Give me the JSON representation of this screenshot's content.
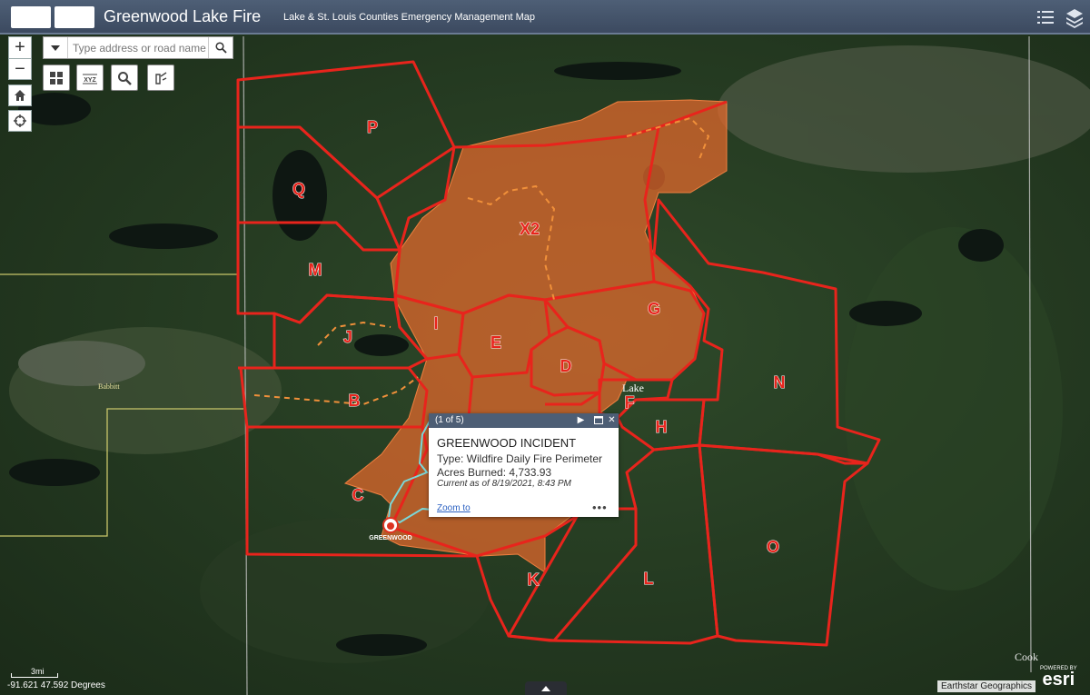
{
  "header": {
    "title": "Greenwood Lake Fire",
    "subtitle": "Lake & St. Louis Counties Emergency Management Map"
  },
  "search": {
    "placeholder": "Type address or road name"
  },
  "map": {
    "zone_labels": [
      "P",
      "Q",
      "M",
      "X2",
      "I",
      "J",
      "E",
      "G",
      "D",
      "B",
      "F",
      "H",
      "N",
      "C",
      "K",
      "L",
      "O"
    ],
    "place_labels": {
      "babbitt": "Babbitt",
      "lake": "Lake",
      "cook": "Cook"
    },
    "incident_marker_label": "GREENWOOD"
  },
  "popup": {
    "count": "(1 of 5)",
    "title": "GREENWOOD INCIDENT",
    "type_line": "Type: Wildfire Daily Fire Perimeter",
    "acres_line": "Acres Burned: 4,733.93",
    "current_line": "Current as of 8/19/2021, 8:43 PM",
    "zoom_link": "Zoom to",
    "more": "•••"
  },
  "status": {
    "coordinates": "-91.621 47.592 Degrees",
    "scale": "3mi",
    "attribution": "Earthstar Geographics",
    "esri_powered": "POWERED BY",
    "esri": "esri"
  },
  "colors": {
    "zone_outline": "#e8241c",
    "fire_fill": "#e86a2c",
    "header": "#46566c",
    "incident_line": "#7ad8d8"
  }
}
